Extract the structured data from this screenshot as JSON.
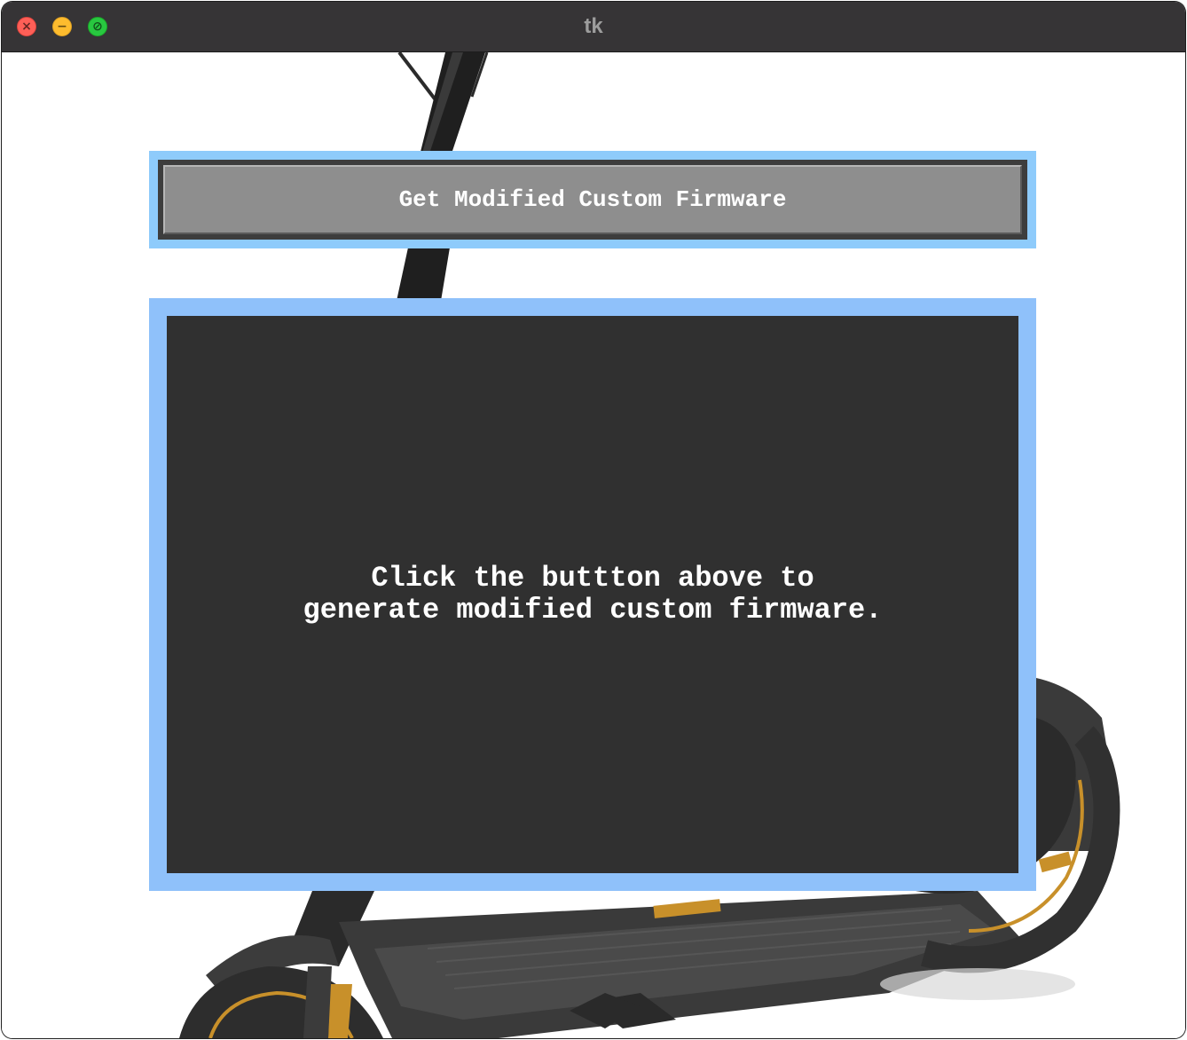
{
  "window": {
    "title": "tk",
    "controls": {
      "close_icon": "close-icon",
      "minimize_icon": "minimize-icon",
      "maximize_icon": "maximize-icon"
    }
  },
  "background_image": "electric-scooter-photo",
  "action_button": {
    "label": "Get Modified Custom Firmware"
  },
  "output_panel": {
    "message": "Click the buttton above to\ngenerate modified custom firmware."
  },
  "colors": {
    "frame_accent": "#8ecbfb",
    "panel_background": "#303030",
    "button_background": "#8e8e8e",
    "titlebar": "#363436"
  }
}
